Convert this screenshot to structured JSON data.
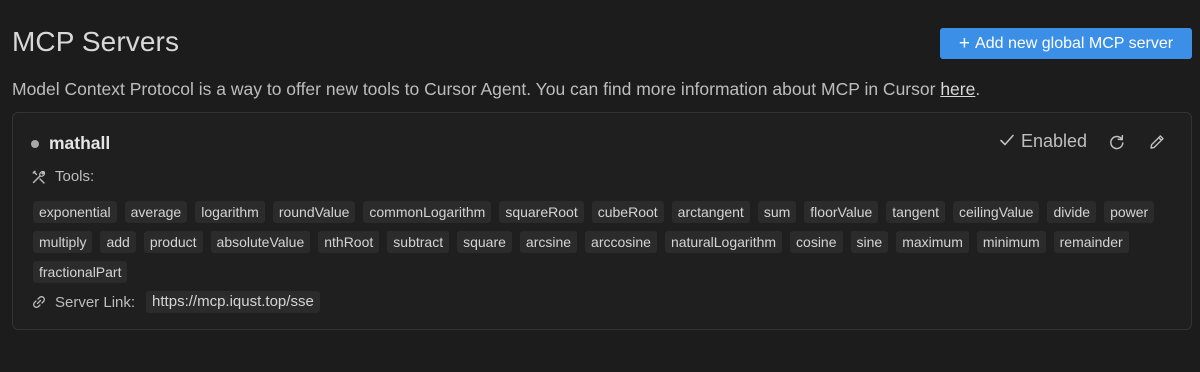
{
  "page": {
    "title": "MCP Servers",
    "add_button_label": "Add new global MCP server",
    "description": "Model Context Protocol is a way to offer new tools to Cursor Agent. You can find more information about MCP in Cursor ",
    "description_link": "here",
    "description_end": "."
  },
  "server": {
    "name": "mathall",
    "status_label": "Enabled",
    "tools_label": "Tools:",
    "tools": [
      "exponential",
      "average",
      "logarithm",
      "roundValue",
      "commonLogarithm",
      "squareRoot",
      "cubeRoot",
      "arctangent",
      "sum",
      "floorValue",
      "tangent",
      "ceilingValue",
      "divide",
      "power",
      "multiply",
      "add",
      "product",
      "absoluteValue",
      "nthRoot",
      "subtract",
      "square",
      "arcsine",
      "arccosine",
      "naturalLogarithm",
      "cosine",
      "sine",
      "maximum",
      "minimum",
      "remainder",
      "fractionalPart"
    ],
    "link_label": "Server Link:",
    "link_url": "https://mcp.iqust.top/sse"
  },
  "icons": {
    "plus": "plus-icon",
    "status": "status-dot-icon",
    "check": "check-icon",
    "refresh": "refresh-icon",
    "edit": "pencil-icon",
    "tools": "tools-icon",
    "link": "link-icon"
  },
  "colors": {
    "background": "#1c1c1c",
    "accent": "#3b8fe6",
    "card": "#1f1f1f",
    "chip": "#2b2b2b"
  }
}
